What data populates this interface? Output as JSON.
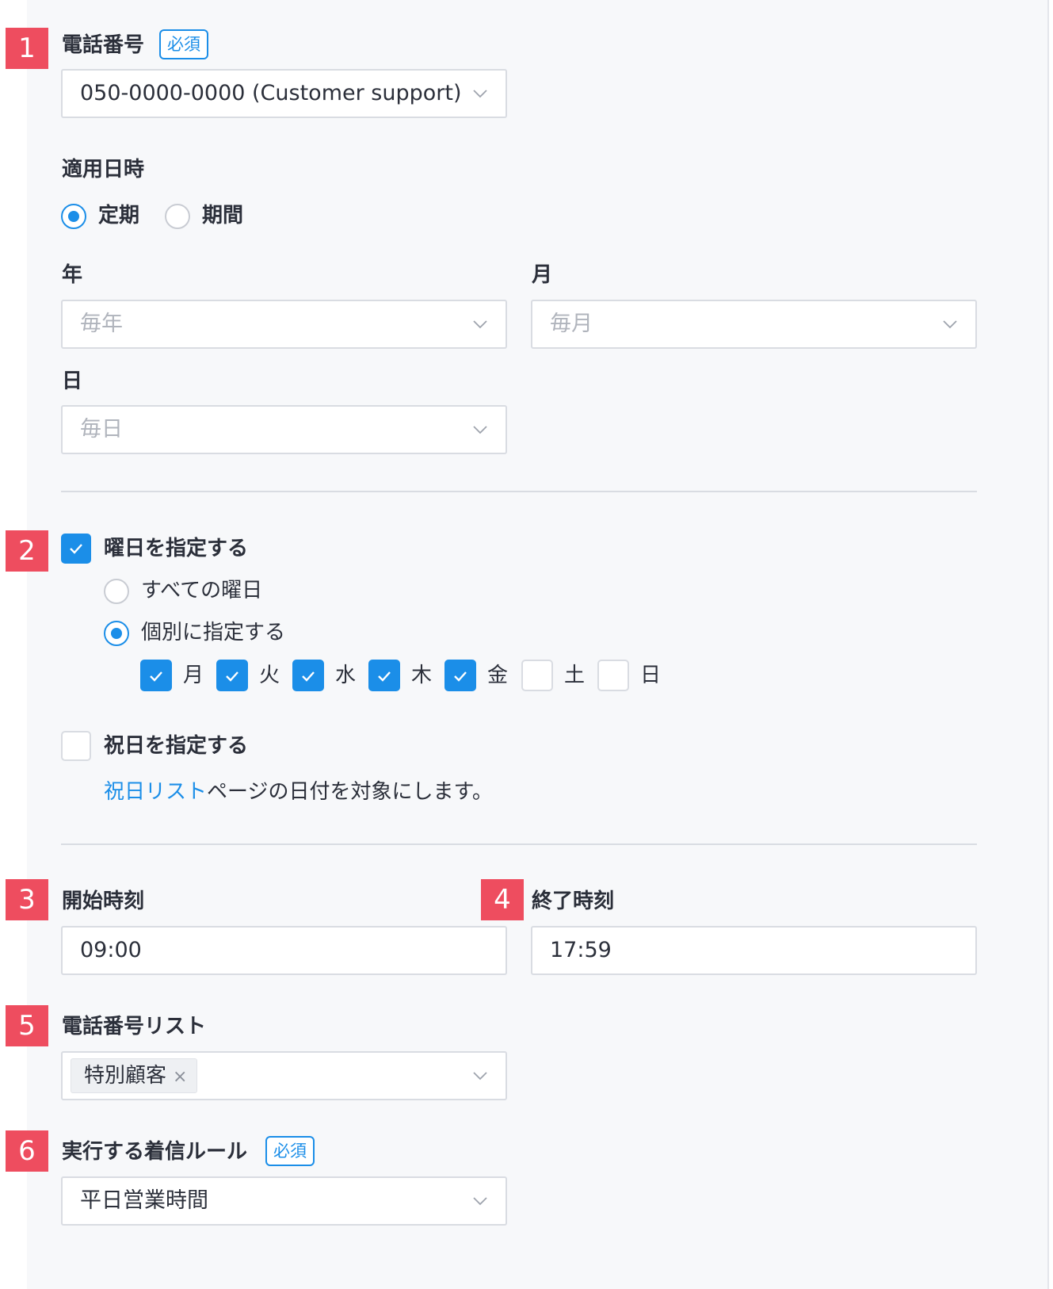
{
  "markers": [
    "1",
    "2",
    "3",
    "4",
    "5",
    "6"
  ],
  "phone": {
    "label": "電話番号",
    "required": "必須",
    "value": "050-0000-0000 (Customer support)"
  },
  "schedule": {
    "label": "適用日時",
    "options": [
      "定期",
      "期間"
    ],
    "selected": "定期",
    "year_label": "年",
    "year_placeholder": "毎年",
    "month_label": "月",
    "month_placeholder": "毎月",
    "day_label": "日",
    "day_placeholder": "毎日"
  },
  "weekday": {
    "label": "曜日を指定する",
    "checked": true,
    "options": [
      "すべての曜日",
      "個別に指定する"
    ],
    "selected": "個別に指定する",
    "days": [
      {
        "label": "月",
        "checked": true
      },
      {
        "label": "火",
        "checked": true
      },
      {
        "label": "水",
        "checked": true
      },
      {
        "label": "木",
        "checked": true
      },
      {
        "label": "金",
        "checked": true
      },
      {
        "label": "土",
        "checked": false
      },
      {
        "label": "日",
        "checked": false
      }
    ]
  },
  "holiday": {
    "label": "祝日を指定する",
    "checked": false,
    "link": "祝日リスト",
    "desc_suffix": "ページの日付を対象にします。"
  },
  "start_time": {
    "label": "開始時刻",
    "value": "09:00"
  },
  "end_time": {
    "label": "終了時刻",
    "value": "17:59"
  },
  "phone_list": {
    "label": "電話番号リスト",
    "tags": [
      "特別顧客"
    ],
    "remove_glyph": "×"
  },
  "rule": {
    "label": "実行する着信ルール",
    "required": "必須",
    "value": "平日営業時間"
  },
  "colors": {
    "accent": "#1b8ee8",
    "marker": "#ee4d5f",
    "panel": "#f7f8fa"
  }
}
